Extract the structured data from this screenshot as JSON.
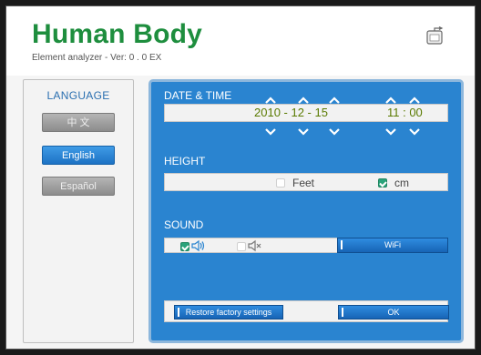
{
  "app": {
    "title": "Human Body",
    "subtitle": "Element analyzer - Ver:  0 . 0 EX"
  },
  "icons": {
    "exit": "exit-icon",
    "speaker_on": "speaker-on-icon",
    "speaker_mute": "speaker-mute-icon",
    "arrow_up": "chevron-up-icon",
    "arrow_down": "chevron-down-icon"
  },
  "colors": {
    "brand_green": "#1e8e3e",
    "panel_blue": "#2a84d0",
    "active_button": "#1d72c4",
    "checkbox_checked": "#2aa37a",
    "datetime_text": "#5a7a00"
  },
  "sidebar": {
    "title": "LANGUAGE",
    "languages": [
      {
        "label": "中 文",
        "selected": false
      },
      {
        "label": "English",
        "selected": true
      },
      {
        "label": "Español",
        "selected": false
      }
    ]
  },
  "datetime": {
    "label": "DATE & TIME",
    "date": "2010  -  12  -  15",
    "time": "11 : 00"
  },
  "height": {
    "label": "HEIGHT",
    "feet_label": "Feet",
    "feet_checked": false,
    "cm_label": "cm",
    "cm_checked": true
  },
  "sound": {
    "label": "SOUND",
    "sound_on_checked": true,
    "mute_checked": false,
    "wifi_label": "WiFi"
  },
  "footer": {
    "restore_label": "Restore factory settings",
    "ok_label": "OK"
  }
}
